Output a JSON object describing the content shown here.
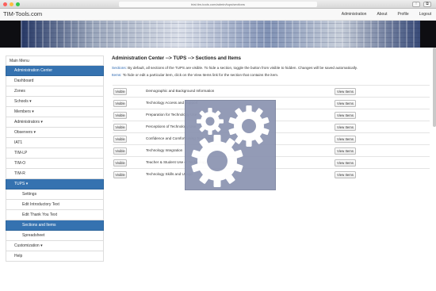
{
  "browser": {
    "url": "trial.tim-tools.com/admin/tups/sections"
  },
  "navbar": {
    "brand": "TIM-Tools.com",
    "links": [
      "Administration",
      "About",
      "Profile",
      "Logout"
    ]
  },
  "sidebar": {
    "header": "Main Menu",
    "items": [
      {
        "label": "Administration Center"
      },
      {
        "label": "Dashboard"
      },
      {
        "label": "Zones"
      },
      {
        "label": "Schools ▾"
      },
      {
        "label": "Members ▾"
      },
      {
        "label": "Administrators ▾"
      },
      {
        "label": "Observers ▾"
      },
      {
        "label": "IAT1"
      },
      {
        "label": "TIM-LP"
      },
      {
        "label": "TIM-O"
      },
      {
        "label": "TIM-R"
      },
      {
        "label": "TUPS ▾"
      },
      {
        "label": "Settings"
      },
      {
        "label": "Edit Introductory Text"
      },
      {
        "label": "Edit Thank You Text"
      },
      {
        "label": "Sections and Items"
      },
      {
        "label": "Spreadsheet"
      },
      {
        "label": "Customization ▾"
      },
      {
        "label": "Help"
      }
    ]
  },
  "main": {
    "title": "Administration Center --> TUPS --> Sections and Items",
    "sections_keyword": "Sections:",
    "sections_text": " By default, all sections of the TUPS are visible. To hide a section, toggle the button from visible to hidden. Changes will be saved automatically.",
    "items_keyword": "Items:",
    "items_text": " To hide or edit a particular item, click on the View Items link for the section that contains the item.",
    "visible_label": "Visible",
    "view_items_label": "View Items",
    "sections": [
      "Demographic and Background Information",
      "Technology Access and Support",
      "Preparation for Technology Use",
      "Perceptions of Technology Use",
      "Confidence and Comfort Using Technology",
      "Technology Integration",
      "Teacher & Student Use of Technology",
      "Technology Skills and Usage"
    ]
  },
  "colors": {
    "active": "#3572b0",
    "link": "#2a66b0",
    "loading_overlay": "#8e96b3"
  },
  "overlay": {
    "icon": "gears-loading-icon"
  }
}
